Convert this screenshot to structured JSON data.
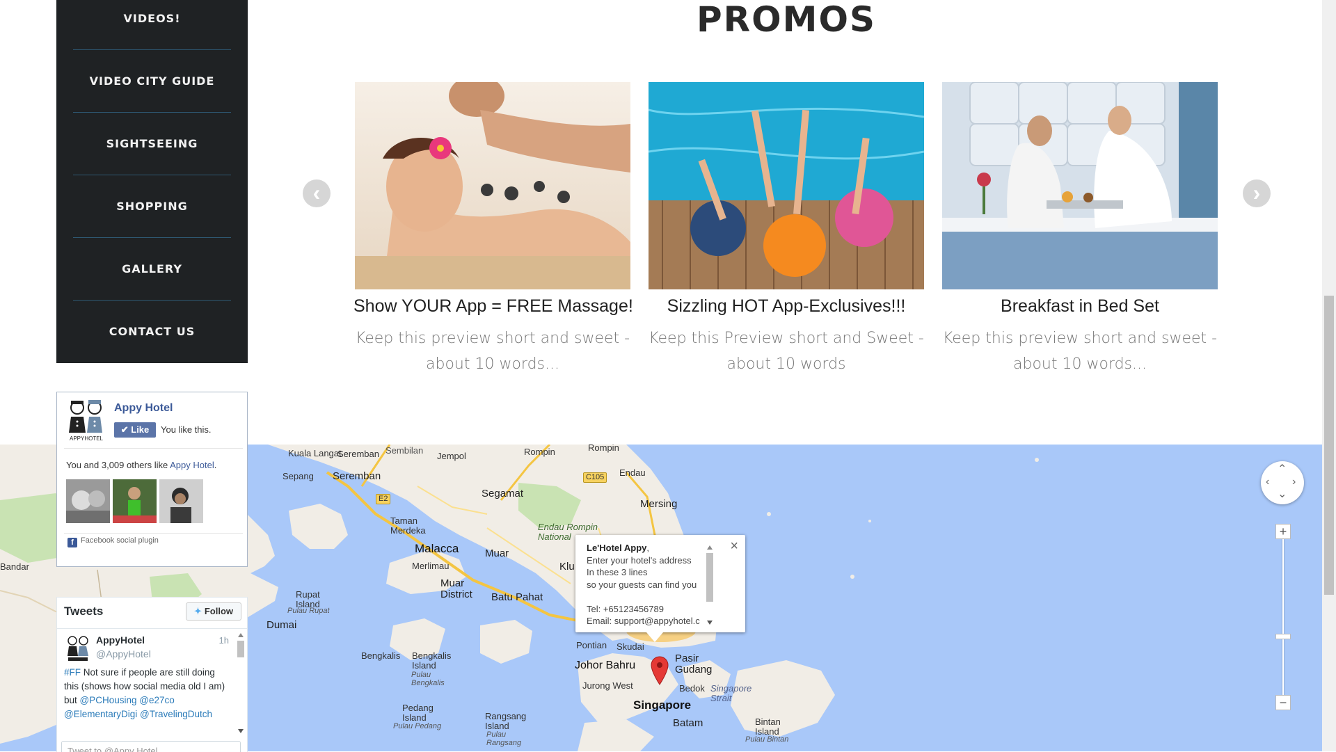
{
  "nav": {
    "items": [
      {
        "label": "VIDEOS!"
      },
      {
        "label": "VIDEO CITY GUIDE"
      },
      {
        "label": "SIGHTSEEING"
      },
      {
        "label": "SHOPPING"
      },
      {
        "label": "GALLERY"
      },
      {
        "label": "CONTACT US"
      }
    ]
  },
  "promos": {
    "title": "PROMOS",
    "prev_icon": "chevron-left-icon",
    "next_icon": "chevron-right-icon",
    "items": [
      {
        "title": "Show YOUR App = FREE Massage!",
        "description": "Keep this preview short and sweet - about 10 words..."
      },
      {
        "title": "Sizzling HOT App-Exclusives!!!",
        "description": "Keep this Preview short and Sweet - about 10 words"
      },
      {
        "title": "Breakfast in Bed Set",
        "description": "Keep this preview short and sweet - about 10 words..."
      }
    ]
  },
  "facebook": {
    "page_name": "Appy Hotel",
    "logo_text": "APPYHOTEL",
    "like_label": "Like",
    "you_like": "You like this.",
    "count_prefix": "You and 3,009 others like ",
    "count_link": "Appy Hotel",
    "count_suffix": ".",
    "plugin_label": "Facebook social plugin",
    "plugin_icon": "f"
  },
  "tweets": {
    "title": "Tweets",
    "follow_label": "Follow",
    "tweet": {
      "name": "AppyHotel",
      "handle": "@AppyHotel",
      "time": "1h",
      "hashtag": "#FF",
      "text": " Not sure if people are still doing this (shows how social media old I am) but ",
      "mentions": [
        "@PCHousing",
        "@e27co",
        "@ElementaryDigi",
        "@TravelingDutch"
      ]
    },
    "compose_placeholder": "Tweet to @Appy Hotel"
  },
  "map": {
    "info": {
      "title": "Le'Hotel Appy",
      "title_suffix": ",",
      "lines": [
        "Enter your hotel's address",
        "In these 3 lines",
        "so your guests can find you",
        "",
        "Tel: +65123456789",
        "Email: support@appyhotel.c"
      ],
      "close": "×"
    },
    "zoom_in": "+",
    "zoom_out": "−",
    "places": [
      {
        "name": "Kuala Langat"
      },
      {
        "name": "Sepang"
      },
      {
        "name": "Seremban"
      },
      {
        "name": "Seremban"
      },
      {
        "name": "Sembilan"
      },
      {
        "name": "Jempol"
      },
      {
        "name": "Rompin"
      },
      {
        "name": "Rompin"
      },
      {
        "name": "Endau"
      },
      {
        "name": "Segamat"
      },
      {
        "name": "Mersing"
      },
      {
        "name": "Taman Merdeka"
      },
      {
        "name": "Malacca"
      },
      {
        "name": "Merlimau"
      },
      {
        "name": "Muar"
      },
      {
        "name": "Endau Rompin National"
      },
      {
        "name": "Klu"
      },
      {
        "name": "Muar District"
      },
      {
        "name": "Batu Pahat"
      },
      {
        "name": "Rupat Island"
      },
      {
        "name": "Pulau Rupat"
      },
      {
        "name": "Dumai"
      },
      {
        "name": "Bandar"
      },
      {
        "name": "Pontian"
      },
      {
        "name": "Skudai"
      },
      {
        "name": "Johor Bahru"
      },
      {
        "name": "Pasir Gudang"
      },
      {
        "name": "Jurong West"
      },
      {
        "name": "Bedok"
      },
      {
        "name": "Singapore"
      },
      {
        "name": "Singapore Strait"
      },
      {
        "name": "Bengkalis"
      },
      {
        "name": "Bengkalis Island"
      },
      {
        "name": "Pulau Bengkalis"
      },
      {
        "name": "Pedang Island"
      },
      {
        "name": "Pulau Pedang"
      },
      {
        "name": "Rangsang Island"
      },
      {
        "name": "Pulau Rangsang"
      },
      {
        "name": "Batam"
      },
      {
        "name": "Bintan Island"
      },
      {
        "name": "Pulau Bintan"
      }
    ],
    "highways": [
      "E2",
      "C105"
    ]
  },
  "colors": {
    "nav_bg": "#1f2224",
    "nav_separator": "#2e5872",
    "map_water": "#a9c8f9",
    "map_land": "#f1ede6",
    "fb_blue": "#3b5998",
    "twitter_blue": "#55acee",
    "marker": "#e53935"
  }
}
